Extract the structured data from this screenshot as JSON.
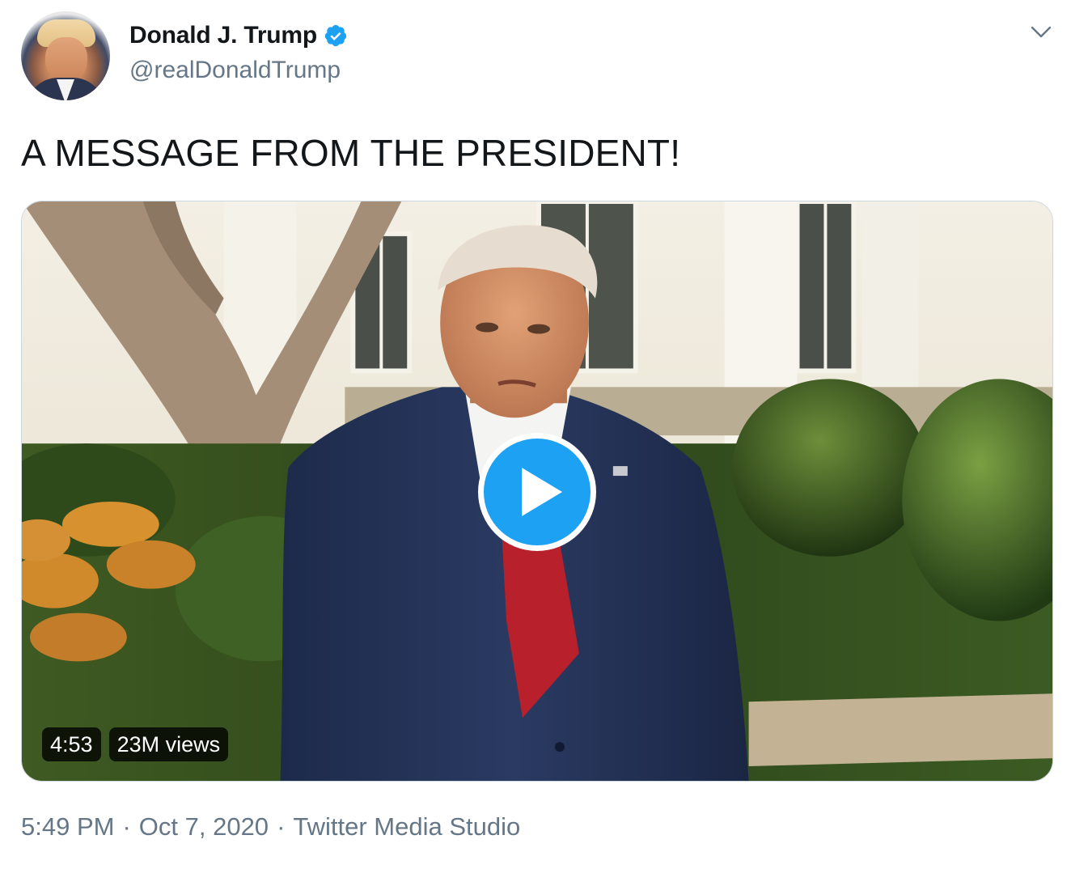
{
  "user": {
    "display_name": "Donald J. Trump",
    "handle": "@realDonaldTrump",
    "verified": true,
    "avatar_icon": "profile-photo"
  },
  "tweet": {
    "text": "A MESSAGE FROM THE PRESIDENT!"
  },
  "media": {
    "type": "video",
    "duration": "4:53",
    "views": "23M views",
    "play_icon": "play-icon"
  },
  "meta": {
    "time": "5:49 PM",
    "separator": "·",
    "date": "Oct 7, 2020",
    "source": "Twitter Media Studio"
  },
  "colors": {
    "accent": "#1da1f2",
    "text_primary": "#14171a",
    "text_secondary": "#657786"
  },
  "icons": {
    "verified": "verified-badge-icon",
    "caret": "chevron-down-icon"
  }
}
